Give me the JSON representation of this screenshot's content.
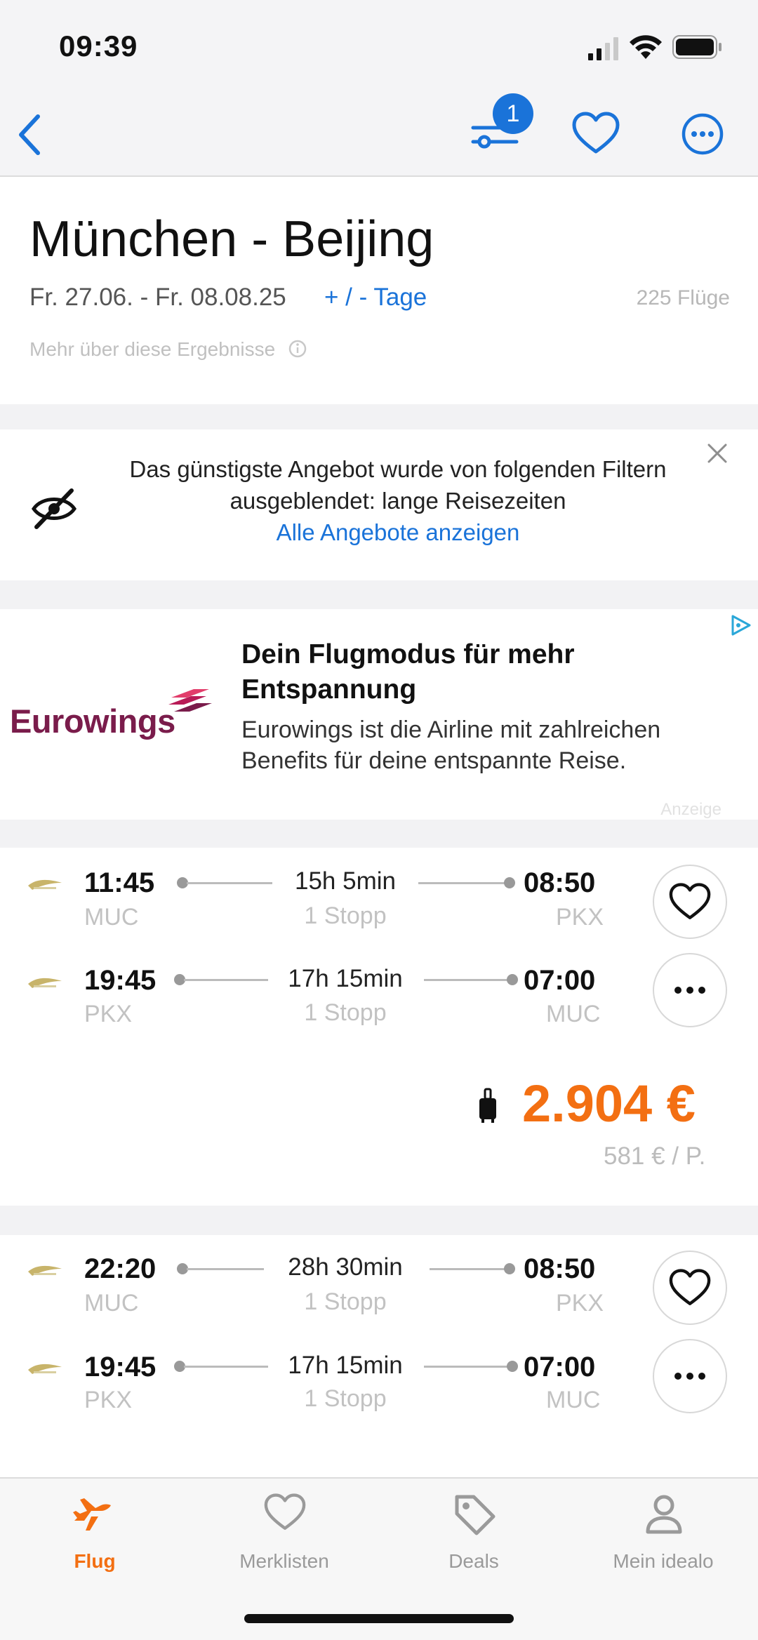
{
  "status_bar": {
    "time": "09:39"
  },
  "nav": {
    "filter_badge": "1"
  },
  "header": {
    "title": "München - Beijing",
    "dates": "Fr. 27.06. - Fr. 08.08.25",
    "days_link": "+ / - Tage",
    "flight_count": "225 Flüge",
    "more_results": "Mehr über diese Ergebnisse"
  },
  "notice": {
    "text": "Das günstigste Angebot wurde von folgenden Filtern ausgeblendet: lange Reisezeiten",
    "link": "Alle Angebote anzeigen"
  },
  "ad": {
    "brand": "Eurowings",
    "title": "Dein Flugmodus für mehr Entspannung",
    "body": "Eurowings ist die Airline mit zahlreichen Benefits für deine entspannte Reise.",
    "label": "Anzeige"
  },
  "results": [
    {
      "outbound": {
        "dep_time": "11:45",
        "dep_code": "MUC",
        "duration": "15h 5min",
        "stops": "1 Stopp",
        "arr_time": "08:50",
        "arr_code": "PKX"
      },
      "inbound": {
        "dep_time": "19:45",
        "dep_code": "PKX",
        "duration": "17h 15min",
        "stops": "1 Stopp",
        "arr_time": "07:00",
        "arr_code": "MUC"
      },
      "price": "2.904 €",
      "per_person": "581 € / P."
    },
    {
      "outbound": {
        "dep_time": "22:20",
        "dep_code": "MUC",
        "duration": "28h 30min",
        "stops": "1 Stopp",
        "arr_time": "08:50",
        "arr_code": "PKX"
      },
      "inbound": {
        "dep_time": "19:45",
        "dep_code": "PKX",
        "duration": "17h 15min",
        "stops": "1 Stopp",
        "arr_time": "07:00",
        "arr_code": "MUC"
      }
    }
  ],
  "tabs": [
    {
      "label": "Flug",
      "icon": "plane-icon",
      "active": true
    },
    {
      "label": "Merklisten",
      "icon": "heart-icon",
      "active": false
    },
    {
      "label": "Deals",
      "icon": "tag-icon",
      "active": false
    },
    {
      "label": "Mein idealo",
      "icon": "person-icon",
      "active": false
    }
  ],
  "colors": {
    "accent": "#1a73d9",
    "price": "#f36f12",
    "brand": "#7a1c4b"
  }
}
